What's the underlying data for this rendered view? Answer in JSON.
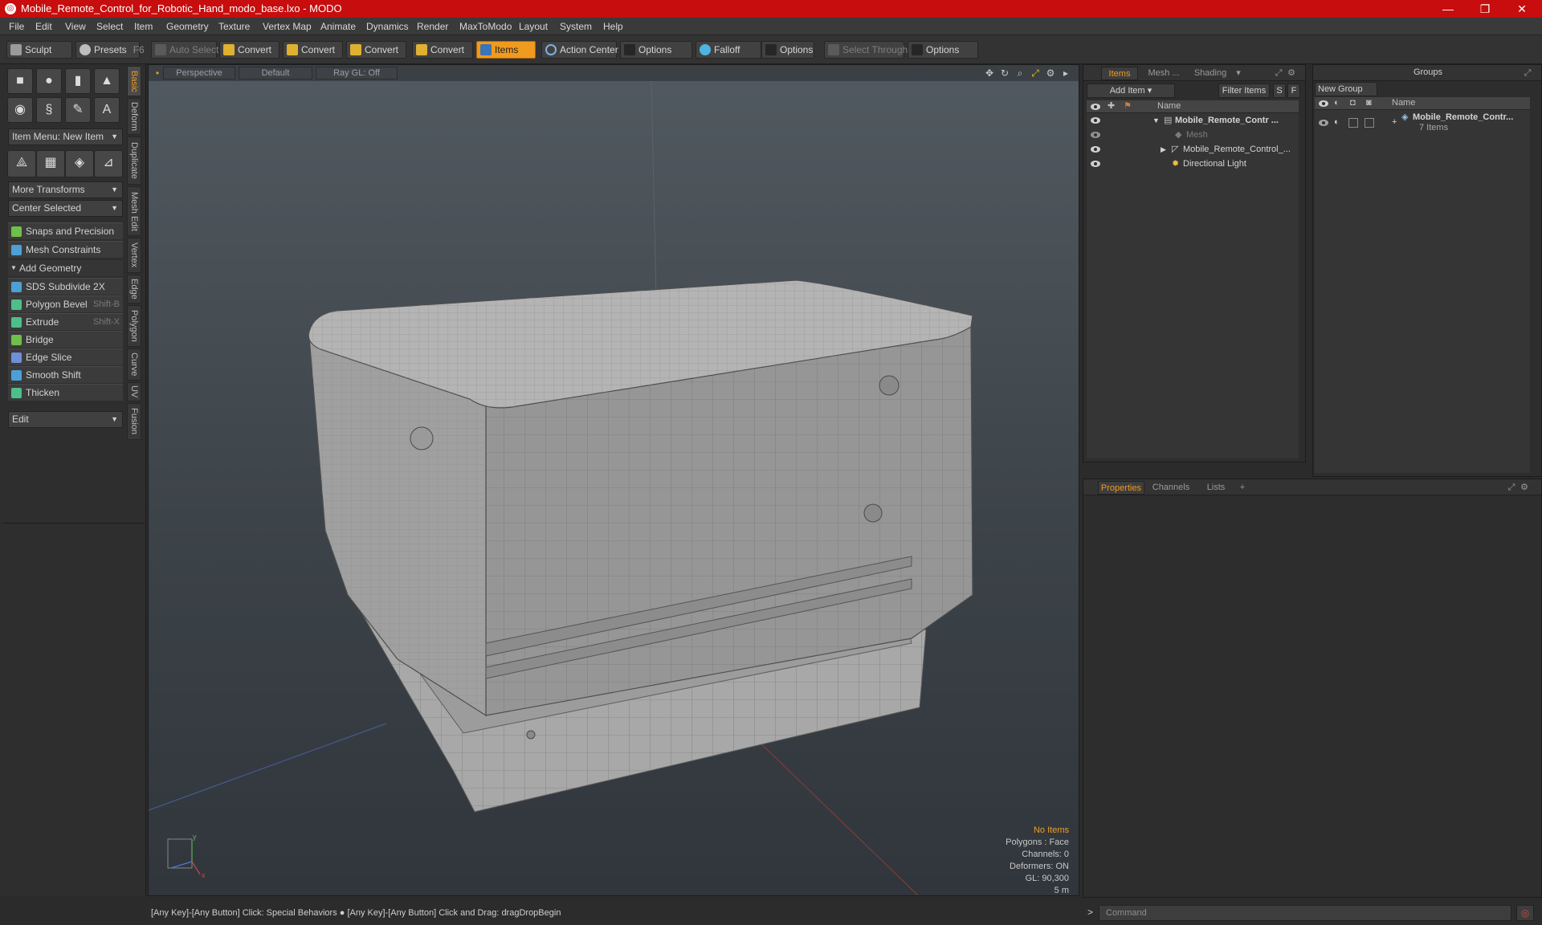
{
  "window": {
    "title": "Mobile_Remote_Control_for_Robotic_Hand_modo_base.lxo - MODO",
    "controls": [
      "—",
      "❐",
      "✕"
    ]
  },
  "menu": [
    "File",
    "Edit",
    "View",
    "Select",
    "Item",
    "Geometry",
    "Texture",
    "Vertex Map",
    "Animate",
    "Dynamics",
    "Render",
    "MaxToModo",
    "Layout",
    "System",
    "Help"
  ],
  "toolbar": {
    "sculpt": "Sculpt",
    "presets": "Presets",
    "presets_key": "F6",
    "auto_select": "Auto Select",
    "convert1": "Convert",
    "convert2": "Convert",
    "convert3": "Convert",
    "convert4": "Convert",
    "items": "Items",
    "action_center": "Action Center",
    "options1": "Options",
    "falloff": "Falloff",
    "options2": "Options",
    "select_through": "Select Through",
    "options3": "Options"
  },
  "left": {
    "item_menu": "Item Menu: New Item",
    "more_transforms": "More Transforms",
    "center_selected": "Center Selected",
    "snaps": "Snaps and Precision",
    "mesh_constraints": "Mesh Constraints",
    "add_geometry": "Add Geometry",
    "tools": [
      {
        "label": "SDS Subdivide 2X",
        "key": ""
      },
      {
        "label": "Polygon Bevel",
        "key": "Shift-B"
      },
      {
        "label": "Extrude",
        "key": "Shift-X"
      },
      {
        "label": "Bridge",
        "key": ""
      },
      {
        "label": "Edge Slice",
        "key": ""
      },
      {
        "label": "Smooth Shift",
        "key": ""
      },
      {
        "label": "Thicken",
        "key": ""
      }
    ],
    "edit": "Edit",
    "vtabs": [
      "Basic",
      "Deform",
      "Duplicate",
      "Mesh Edit",
      "Vertex",
      "Edge",
      "Polygon",
      "Curve",
      "UV",
      "Fusion"
    ]
  },
  "viewport": {
    "perspective": "Perspective",
    "default": "Default",
    "raygl": "Ray GL: Off",
    "info": {
      "no_items": "No Items",
      "polygons": "Polygons : Face",
      "channels": "Channels: 0",
      "deformers": "Deformers: ON",
      "gl": "GL: 90,300",
      "scale": "5 m"
    }
  },
  "status": "[Any Key]-[Any Button] Click: Special Behaviors ● [Any Key]-[Any Button] Click and Drag: dragDropBegin",
  "command_placeholder": "Command",
  "items_panel": {
    "tabs": [
      "Items",
      "Mesh ...",
      "Shading"
    ],
    "add_item": "Add Item",
    "filter_items": "Filter Items",
    "s": "S",
    "f": "F",
    "name_col": "Name",
    "rows": [
      {
        "label": "Mobile_Remote_Contr ..."
      },
      {
        "label": "Mesh"
      },
      {
        "label": "Mobile_Remote_Control_..."
      },
      {
        "label": "Directional Light"
      }
    ]
  },
  "groups_panel": {
    "title": "Groups",
    "new_group": "New Group",
    "name_col": "Name",
    "group_name": "Mobile_Remote_Contr...",
    "group_count": "7 Items"
  },
  "props_panel": {
    "tabs": [
      "Properties",
      "Channels",
      "Lists"
    ],
    "plus": "+"
  }
}
